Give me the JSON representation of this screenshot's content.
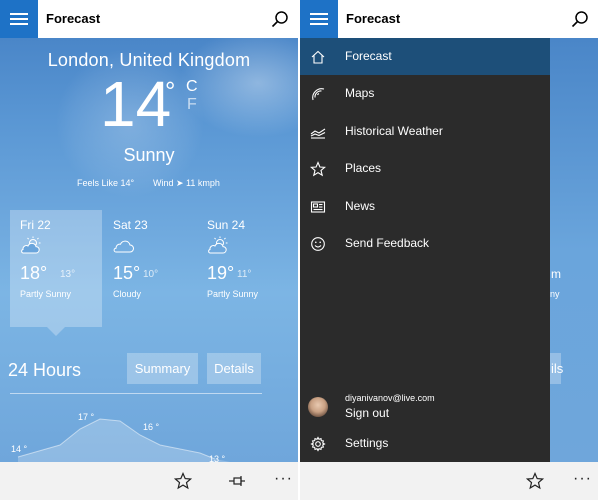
{
  "colors": {
    "accent": "#1e72c6",
    "drawer_bg": "#2b2b2b",
    "drawer_active": "#1d4f79",
    "bottom_bar": "#f2f2f2"
  },
  "header": {
    "title": "Forecast",
    "menu_icon": "hamburger-icon",
    "search_icon": "search-icon"
  },
  "current": {
    "location": "London, United Kingdom",
    "temperature": "14",
    "degree": "°",
    "unit_c": "C",
    "unit_f": "F",
    "condition": "Sunny",
    "feels_like": "Feels Like  14°",
    "wind": "Wind ➤ 11 kmph"
  },
  "days": [
    {
      "name": "Fri 22",
      "high": "18°",
      "low": "13°",
      "condition": "Partly Sunny",
      "icon": "partly-sunny-icon",
      "selected": true
    },
    {
      "name": "Sat 23",
      "high": "15°",
      "low": "10°",
      "condition": "Cloudy",
      "icon": "cloudy-icon",
      "selected": false
    },
    {
      "name": "Sun 24",
      "high": "19°",
      "low": "11°",
      "condition": "Partly Sunny",
      "icon": "partly-sunny-icon",
      "selected": false
    }
  ],
  "hours": {
    "title": "24 Hours",
    "tabs": [
      "Summary",
      "Details"
    ],
    "graph_labels": [
      "14 °",
      "17 °",
      "16 °",
      "13 °"
    ]
  },
  "bottom_bar": {
    "icons": [
      "star-icon",
      "pin-icon"
    ],
    "more": "···"
  },
  "drawer": {
    "items": [
      {
        "label": "Forecast",
        "icon": "home-icon",
        "active": true
      },
      {
        "label": "Maps",
        "icon": "radar-icon",
        "active": false
      },
      {
        "label": "Historical Weather",
        "icon": "chart-icon",
        "active": false
      },
      {
        "label": "Places",
        "icon": "star-icon",
        "active": false
      },
      {
        "label": "News",
        "icon": "news-icon",
        "active": false
      },
      {
        "label": "Send Feedback",
        "icon": "smiley-icon",
        "active": false
      }
    ],
    "account": {
      "email": "diyanivanov@live.com",
      "action": "Sign out"
    },
    "settings": "Settings"
  },
  "right_strip": {
    "text_a": "m",
    "text_b": "ny",
    "text_c": "ils"
  }
}
